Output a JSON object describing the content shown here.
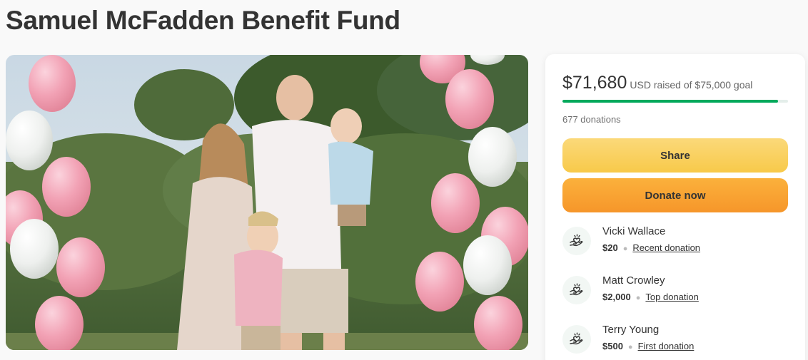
{
  "page": {
    "title": "Samuel McFadden Benefit Fund"
  },
  "fundraiser": {
    "raised": "$71,680",
    "raised_suffix": "USD raised of $75,000 goal",
    "progress_fraction": 0.956,
    "donations": "677 donations",
    "share_label": "Share",
    "donate_label": "Donate now"
  },
  "donors": [
    {
      "name": "Vicki Wallace",
      "amount": "$20",
      "tag": "Recent donation"
    },
    {
      "name": "Matt Crowley",
      "amount": "$2,000",
      "tag": "Top donation"
    },
    {
      "name": "Terry Young",
      "amount": "$500",
      "tag": "First donation"
    }
  ],
  "colors": {
    "progress": "#02a95c",
    "share_button": "#f8c94a",
    "donate_button": "#f6962a"
  },
  "icons": {
    "donor": "heart-hand-icon"
  }
}
